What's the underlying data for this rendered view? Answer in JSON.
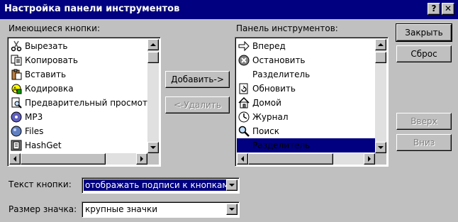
{
  "window": {
    "title": "Настройка панели инструментов",
    "help_glyph": "?",
    "close_glyph": "✕"
  },
  "available": {
    "label": "Имеющиеся кнопки:",
    "items": [
      {
        "icon": "scissors-icon",
        "label": "Вырезать"
      },
      {
        "icon": "copy-icon",
        "label": "Копировать"
      },
      {
        "icon": "paste-icon",
        "label": "Вставить"
      },
      {
        "icon": "encoding-icon",
        "label": "Кодировка"
      },
      {
        "icon": "print-preview-icon",
        "label": "Предварительный просмотр"
      },
      {
        "icon": "mp3-icon",
        "label": "MP3"
      },
      {
        "icon": "files-icon",
        "label": "Files"
      },
      {
        "icon": "hashget-icon",
        "label": "HashGet"
      }
    ]
  },
  "toolbar": {
    "label": "Панель инструментов:",
    "items": [
      {
        "icon": "forward-arrow-icon",
        "label": "Вперед",
        "selected": false
      },
      {
        "icon": "stop-icon",
        "label": "Остановить",
        "selected": false
      },
      {
        "icon": "",
        "label": "Разделитель",
        "selected": false
      },
      {
        "icon": "refresh-icon",
        "label": "Обновить",
        "selected": false
      },
      {
        "icon": "home-icon",
        "label": "Домой",
        "selected": false
      },
      {
        "icon": "history-icon",
        "label": "Журнал",
        "selected": false
      },
      {
        "icon": "search-icon",
        "label": "Поиск",
        "selected": false
      },
      {
        "icon": "",
        "label": "Разделитель",
        "selected": true
      }
    ]
  },
  "buttons": {
    "add": "Добавить->",
    "remove": "<-Удалить",
    "close": "Закрыть",
    "reset": "Сброс",
    "up": "Вверх",
    "down": "Вниз"
  },
  "text_options": {
    "label": "Текст кнопки:",
    "value": "отображать подписи к кнопкам"
  },
  "icon_options": {
    "label": "Размер значка:",
    "value": "крупные значки"
  },
  "colors": {
    "titlebar": "#000080",
    "face": "#c0c0c0",
    "selection": "#000080"
  }
}
